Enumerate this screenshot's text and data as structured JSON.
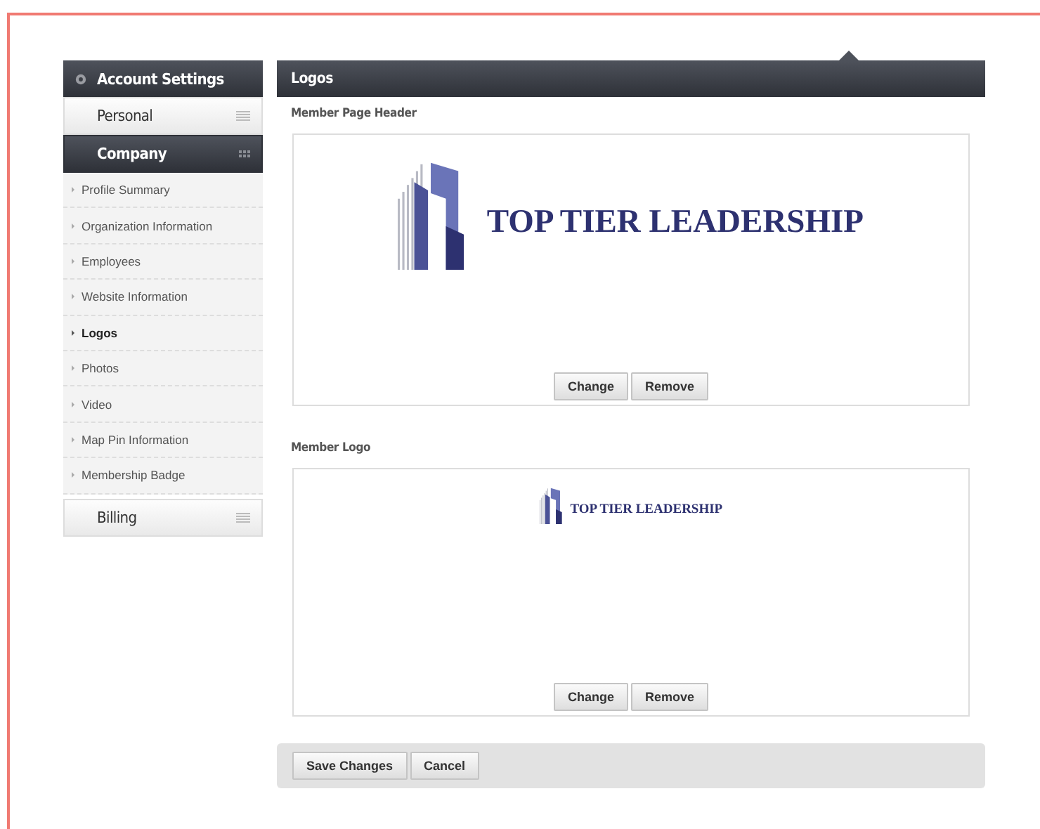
{
  "sidebar": {
    "title": "Account Settings",
    "sections": [
      {
        "label": "Personal",
        "expanded": false
      },
      {
        "label": "Company",
        "expanded": true,
        "items": [
          {
            "label": "Profile Summary",
            "selected": false
          },
          {
            "label": "Organization Information",
            "selected": false
          },
          {
            "label": "Employees",
            "selected": false
          },
          {
            "label": "Website Information",
            "selected": false
          },
          {
            "label": "Logos",
            "selected": true
          },
          {
            "label": "Photos",
            "selected": false
          },
          {
            "label": "Video",
            "selected": false
          },
          {
            "label": "Map Pin Information",
            "selected": false
          },
          {
            "label": "Membership Badge",
            "selected": false
          }
        ]
      },
      {
        "label": "Billing",
        "expanded": false
      }
    ]
  },
  "panel": {
    "title": "Logos",
    "logos": [
      {
        "label": "Member Page Header",
        "kind": "banner",
        "logo_text": "TOP TIER LEADERSHIP",
        "buttons": [
          "Change",
          "Remove"
        ]
      },
      {
        "label": "Member Logo",
        "kind": "thumbnail",
        "logo_text": "TOP TIER LEADERSHIP",
        "buttons": [
          "Change",
          "Remove"
        ]
      }
    ]
  },
  "actions": [
    "Save Changes",
    "Cancel"
  ]
}
